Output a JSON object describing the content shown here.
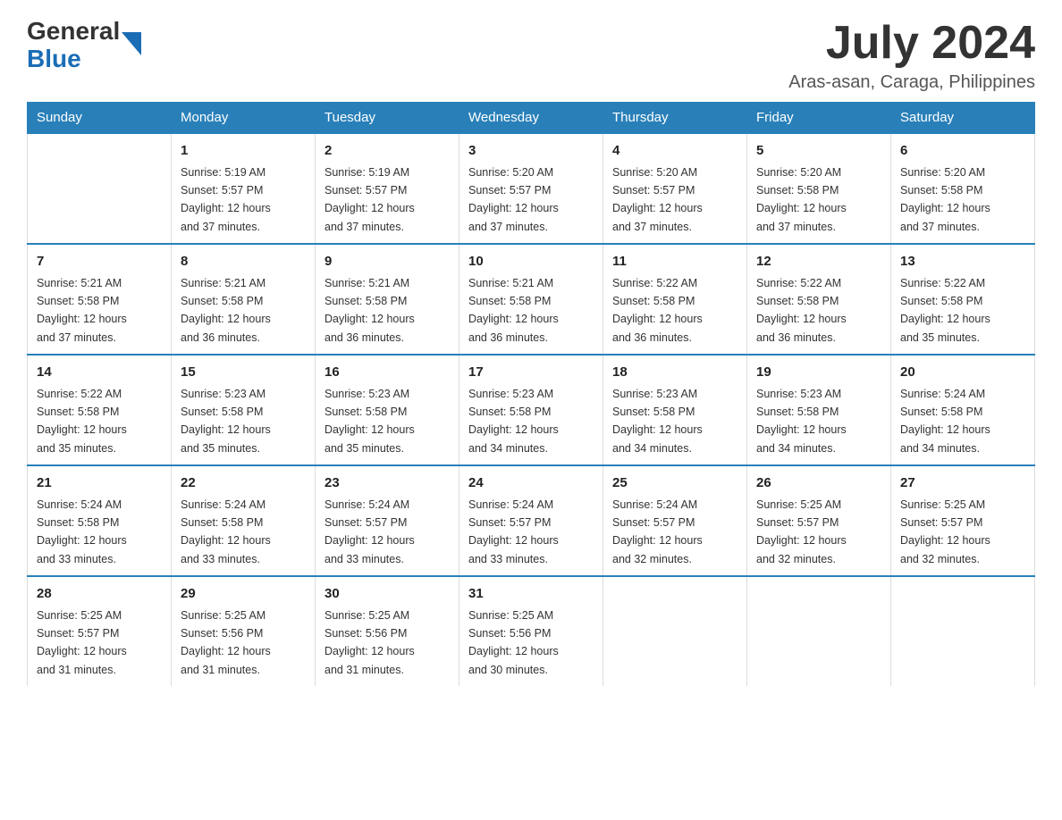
{
  "header": {
    "logo_general": "General",
    "logo_blue": "Blue",
    "month_year": "July 2024",
    "location": "Aras-asan, Caraga, Philippines"
  },
  "days_of_week": [
    "Sunday",
    "Monday",
    "Tuesday",
    "Wednesday",
    "Thursday",
    "Friday",
    "Saturday"
  ],
  "weeks": [
    [
      {
        "day": "",
        "info": ""
      },
      {
        "day": "1",
        "info": "Sunrise: 5:19 AM\nSunset: 5:57 PM\nDaylight: 12 hours\nand 37 minutes."
      },
      {
        "day": "2",
        "info": "Sunrise: 5:19 AM\nSunset: 5:57 PM\nDaylight: 12 hours\nand 37 minutes."
      },
      {
        "day": "3",
        "info": "Sunrise: 5:20 AM\nSunset: 5:57 PM\nDaylight: 12 hours\nand 37 minutes."
      },
      {
        "day": "4",
        "info": "Sunrise: 5:20 AM\nSunset: 5:57 PM\nDaylight: 12 hours\nand 37 minutes."
      },
      {
        "day": "5",
        "info": "Sunrise: 5:20 AM\nSunset: 5:58 PM\nDaylight: 12 hours\nand 37 minutes."
      },
      {
        "day": "6",
        "info": "Sunrise: 5:20 AM\nSunset: 5:58 PM\nDaylight: 12 hours\nand 37 minutes."
      }
    ],
    [
      {
        "day": "7",
        "info": "Sunrise: 5:21 AM\nSunset: 5:58 PM\nDaylight: 12 hours\nand 37 minutes."
      },
      {
        "day": "8",
        "info": "Sunrise: 5:21 AM\nSunset: 5:58 PM\nDaylight: 12 hours\nand 36 minutes."
      },
      {
        "day": "9",
        "info": "Sunrise: 5:21 AM\nSunset: 5:58 PM\nDaylight: 12 hours\nand 36 minutes."
      },
      {
        "day": "10",
        "info": "Sunrise: 5:21 AM\nSunset: 5:58 PM\nDaylight: 12 hours\nand 36 minutes."
      },
      {
        "day": "11",
        "info": "Sunrise: 5:22 AM\nSunset: 5:58 PM\nDaylight: 12 hours\nand 36 minutes."
      },
      {
        "day": "12",
        "info": "Sunrise: 5:22 AM\nSunset: 5:58 PM\nDaylight: 12 hours\nand 36 minutes."
      },
      {
        "day": "13",
        "info": "Sunrise: 5:22 AM\nSunset: 5:58 PM\nDaylight: 12 hours\nand 35 minutes."
      }
    ],
    [
      {
        "day": "14",
        "info": "Sunrise: 5:22 AM\nSunset: 5:58 PM\nDaylight: 12 hours\nand 35 minutes."
      },
      {
        "day": "15",
        "info": "Sunrise: 5:23 AM\nSunset: 5:58 PM\nDaylight: 12 hours\nand 35 minutes."
      },
      {
        "day": "16",
        "info": "Sunrise: 5:23 AM\nSunset: 5:58 PM\nDaylight: 12 hours\nand 35 minutes."
      },
      {
        "day": "17",
        "info": "Sunrise: 5:23 AM\nSunset: 5:58 PM\nDaylight: 12 hours\nand 34 minutes."
      },
      {
        "day": "18",
        "info": "Sunrise: 5:23 AM\nSunset: 5:58 PM\nDaylight: 12 hours\nand 34 minutes."
      },
      {
        "day": "19",
        "info": "Sunrise: 5:23 AM\nSunset: 5:58 PM\nDaylight: 12 hours\nand 34 minutes."
      },
      {
        "day": "20",
        "info": "Sunrise: 5:24 AM\nSunset: 5:58 PM\nDaylight: 12 hours\nand 34 minutes."
      }
    ],
    [
      {
        "day": "21",
        "info": "Sunrise: 5:24 AM\nSunset: 5:58 PM\nDaylight: 12 hours\nand 33 minutes."
      },
      {
        "day": "22",
        "info": "Sunrise: 5:24 AM\nSunset: 5:58 PM\nDaylight: 12 hours\nand 33 minutes."
      },
      {
        "day": "23",
        "info": "Sunrise: 5:24 AM\nSunset: 5:57 PM\nDaylight: 12 hours\nand 33 minutes."
      },
      {
        "day": "24",
        "info": "Sunrise: 5:24 AM\nSunset: 5:57 PM\nDaylight: 12 hours\nand 33 minutes."
      },
      {
        "day": "25",
        "info": "Sunrise: 5:24 AM\nSunset: 5:57 PM\nDaylight: 12 hours\nand 32 minutes."
      },
      {
        "day": "26",
        "info": "Sunrise: 5:25 AM\nSunset: 5:57 PM\nDaylight: 12 hours\nand 32 minutes."
      },
      {
        "day": "27",
        "info": "Sunrise: 5:25 AM\nSunset: 5:57 PM\nDaylight: 12 hours\nand 32 minutes."
      }
    ],
    [
      {
        "day": "28",
        "info": "Sunrise: 5:25 AM\nSunset: 5:57 PM\nDaylight: 12 hours\nand 31 minutes."
      },
      {
        "day": "29",
        "info": "Sunrise: 5:25 AM\nSunset: 5:56 PM\nDaylight: 12 hours\nand 31 minutes."
      },
      {
        "day": "30",
        "info": "Sunrise: 5:25 AM\nSunset: 5:56 PM\nDaylight: 12 hours\nand 31 minutes."
      },
      {
        "day": "31",
        "info": "Sunrise: 5:25 AM\nSunset: 5:56 PM\nDaylight: 12 hours\nand 30 minutes."
      },
      {
        "day": "",
        "info": ""
      },
      {
        "day": "",
        "info": ""
      },
      {
        "day": "",
        "info": ""
      }
    ]
  ]
}
